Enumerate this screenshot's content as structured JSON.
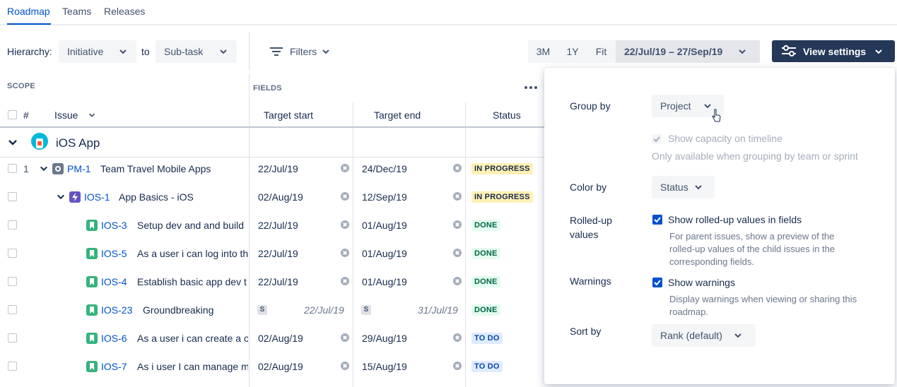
{
  "tabs": [
    {
      "label": "Roadmap"
    },
    {
      "label": "Teams"
    },
    {
      "label": "Releases"
    }
  ],
  "toolbar": {
    "hierarchy_label": "Hierarchy:",
    "from_value": "Initiative",
    "to_label": "to",
    "to_value": "Sub-task",
    "filters_label": "Filters",
    "range_3m": "3M",
    "range_1y": "1Y",
    "range_fit": "Fit",
    "date_range": "22/Jul/19 – 27/Sep/19",
    "view_settings": "View settings"
  },
  "table": {
    "scope_label": "SCOPE",
    "fields_label": "FIELDS",
    "headers": {
      "num": "#",
      "issue": "Issue",
      "target_start": "Target start",
      "target_end": "Target end",
      "status": "Status"
    },
    "group": {
      "name": "iOS App"
    },
    "rows": [
      {
        "num": "1",
        "key": "PM-1",
        "summary": "Team Travel Mobile Apps",
        "start": "22/Jul/19",
        "end": "24/Dec/19",
        "status": "IN PROGRESS"
      },
      {
        "num": "",
        "key": "IOS-1",
        "summary": "App Basics - iOS",
        "start": "02/Aug/19",
        "end": "12/Sep/19",
        "status": "IN PROGRESS"
      },
      {
        "num": "",
        "key": "IOS-3",
        "summary": "Setup dev and and build",
        "start": "22/Jul/19",
        "end": "01/Aug/19",
        "status": "DONE"
      },
      {
        "num": "",
        "key": "IOS-5",
        "summary": "As a user i can log into th",
        "start": "22/Jul/19",
        "end": "01/Aug/19",
        "status": "DONE"
      },
      {
        "num": "",
        "key": "IOS-4",
        "summary": "Establish basic app dev t",
        "start": "22/Jul/19",
        "end": "01/Aug/19",
        "status": "DONE"
      },
      {
        "num": "",
        "key": "IOS-23",
        "summary": "Groundbreaking",
        "start": "22/Jul/19",
        "end": "31/Jul/19",
        "status": "DONE",
        "badge": "S"
      },
      {
        "num": "",
        "key": "IOS-6",
        "summary": "As a user i can create a c",
        "start": "02/Aug/19",
        "end": "29/Aug/19",
        "status": "TO DO"
      },
      {
        "num": "",
        "key": "IOS-7",
        "summary": "As i user I can manage m",
        "start": "02/Aug/19",
        "end": "15/Aug/19",
        "status": "TO DO"
      }
    ]
  },
  "settings": {
    "group_by_label": "Group by",
    "group_by_value": "Project",
    "capacity_label": "Show capacity on timeline",
    "capacity_help": "Only available when grouping by team or sprint",
    "color_by_label": "Color by",
    "color_by_value": "Status",
    "rolled_up_label_1": "Rolled-up",
    "rolled_up_label_2": "values",
    "rolled_up_option": "Show rolled-up values in fields",
    "rolled_up_help_1": "For parent issues, show a preview of the",
    "rolled_up_help_2": "rolled-up values of the child issues in the",
    "rolled_up_help_3": "corresponding fields.",
    "warnings_label": "Warnings",
    "warnings_option": "Show warnings",
    "warnings_help_1": "Display warnings when viewing or sharing this",
    "warnings_help_2": "roadmap.",
    "sort_by_label": "Sort by",
    "sort_by_value": "Rank (default)"
  },
  "colors": {
    "brand_blue": "#0052CC",
    "nav_dark": "#253858",
    "story_green": "#36B37E",
    "epic_purple": "#6554C0",
    "initiative_gray": "#6B778C"
  }
}
